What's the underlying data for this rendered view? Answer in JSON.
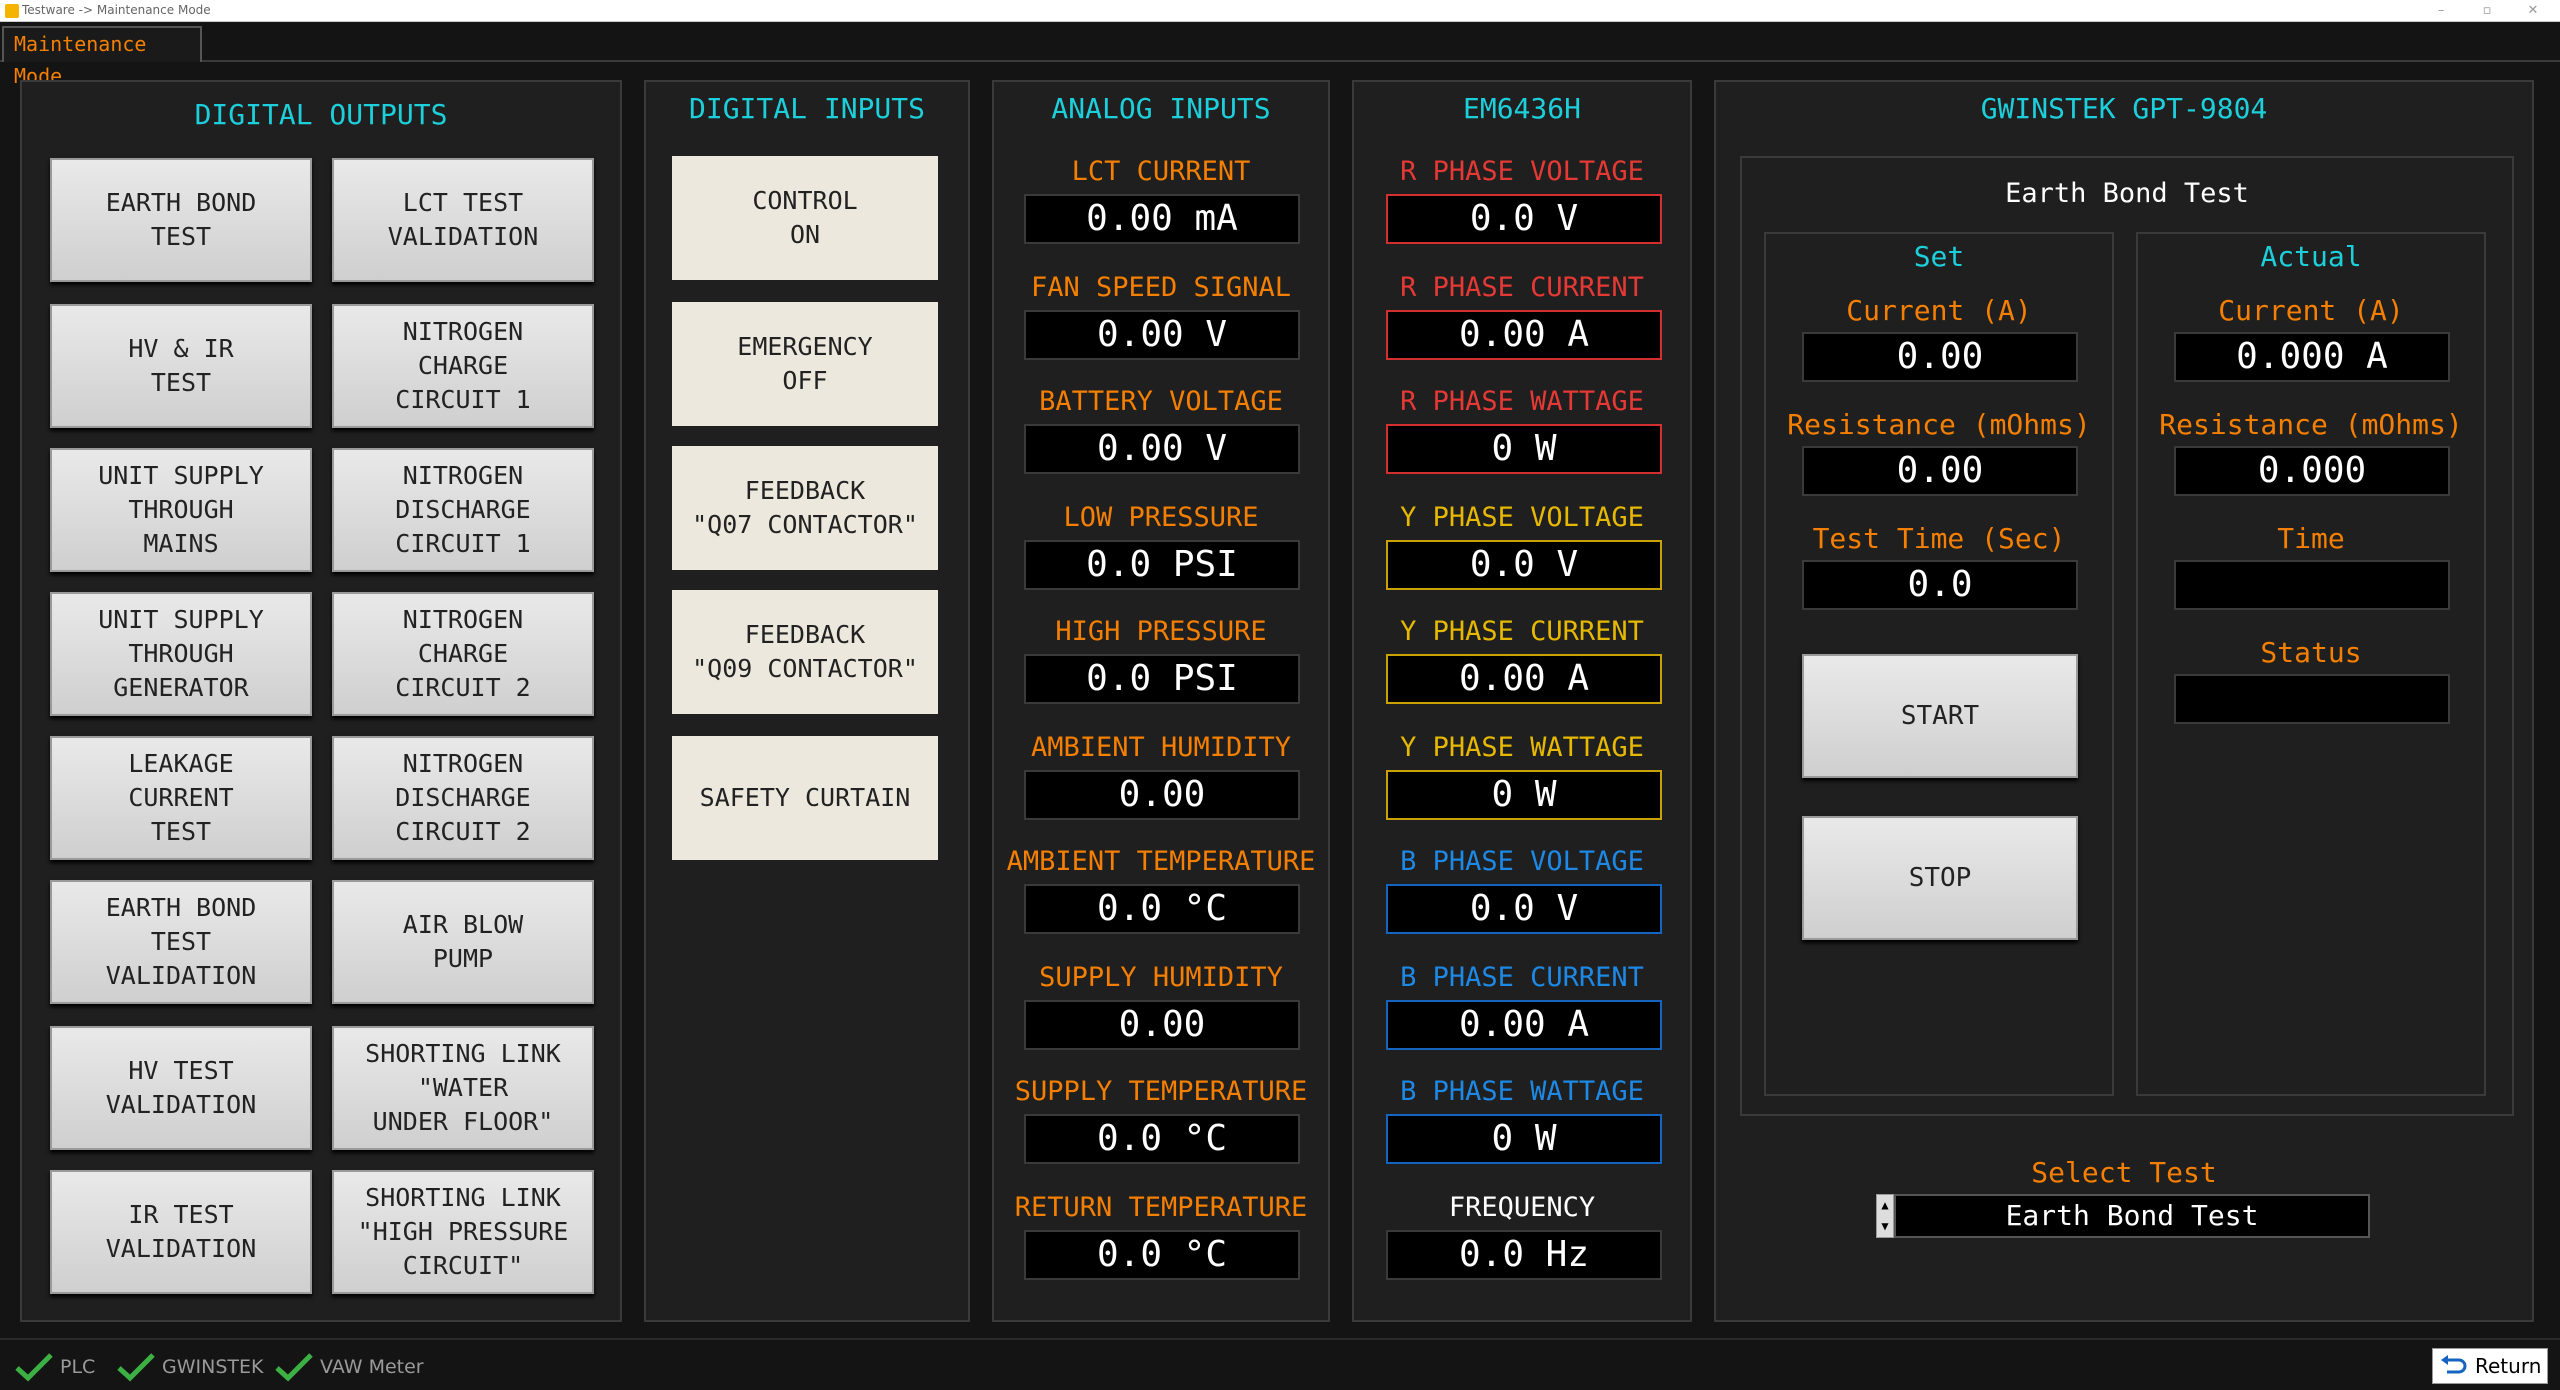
{
  "window": {
    "title": "Testware -> Maintenance Mode",
    "min": "–",
    "max": "▫",
    "close": "✕"
  },
  "tab": {
    "label": "Maintenance Mode"
  },
  "digital_outputs": {
    "title": "DIGITAL OUTPUTS",
    "left": [
      "EARTH BOND\nTEST",
      "HV & IR\nTEST",
      "UNIT SUPPLY\nTHROUGH\nMAINS",
      "UNIT SUPPLY\nTHROUGH\nGENERATOR",
      "LEAKAGE\nCURRENT\nTEST",
      "EARTH BOND\nTEST\nVALIDATION",
      "HV TEST\nVALIDATION",
      "IR TEST\nVALIDATION"
    ],
    "right": [
      "LCT TEST\nVALIDATION",
      "NITROGEN\nCHARGE\nCIRCUIT 1",
      "NITROGEN\nDISCHARGE\nCIRCUIT 1",
      "NITROGEN\nCHARGE\nCIRCUIT 2",
      "NITROGEN\nDISCHARGE\nCIRCUIT 2",
      "AIR BLOW\nPUMP",
      "SHORTING LINK\n\"WATER\nUNDER FLOOR\"",
      "SHORTING LINK\n\"HIGH PRESSURE\nCIRCUIT\""
    ]
  },
  "digital_inputs": {
    "title": "DIGITAL INPUTS",
    "items": [
      "CONTROL\nON",
      "EMERGENCY\nOFF",
      "FEEDBACK\n\"Q07 CONTACTOR\"",
      "FEEDBACK\n\"Q09 CONTACTOR\"",
      "SAFETY CURTAIN"
    ]
  },
  "analog_inputs": {
    "title": "ANALOG INPUTS",
    "items": [
      {
        "label": "LCT CURRENT",
        "value": "0.00 mA"
      },
      {
        "label": "FAN SPEED SIGNAL",
        "value": "0.00 V"
      },
      {
        "label": "BATTERY VOLTAGE",
        "value": "0.00 V"
      },
      {
        "label": "LOW PRESSURE",
        "value": "0.0 PSI"
      },
      {
        "label": "HIGH PRESSURE",
        "value": "0.0 PSI"
      },
      {
        "label": "AMBIENT HUMIDITY",
        "value": "0.00"
      },
      {
        "label": "AMBIENT TEMPERATURE",
        "value": "0.0 °C"
      },
      {
        "label": "SUPPLY HUMIDITY",
        "value": "0.00"
      },
      {
        "label": "SUPPLY TEMPERATURE",
        "value": "0.0 °C"
      },
      {
        "label": "RETURN TEMPERATURE",
        "value": "0.0 °C"
      }
    ]
  },
  "em6436h": {
    "title": "EM6436H",
    "items": [
      {
        "label": "R PHASE VOLTAGE",
        "value": "0.0 V",
        "color": "#e53935"
      },
      {
        "label": "R PHASE CURRENT",
        "value": "0.00 A",
        "color": "#e53935"
      },
      {
        "label": "R PHASE WATTAGE",
        "value": "0 W",
        "color": "#e53935"
      },
      {
        "label": "Y PHASE VOLTAGE",
        "value": "0.0 V",
        "color": "#e6b800"
      },
      {
        "label": "Y PHASE CURRENT",
        "value": "0.00 A",
        "color": "#e6b800"
      },
      {
        "label": "Y PHASE WATTAGE",
        "value": "0 W",
        "color": "#e6b800"
      },
      {
        "label": "B PHASE VOLTAGE",
        "value": "0.0 V",
        "color": "#1e88e5"
      },
      {
        "label": "B PHASE CURRENT",
        "value": "0.00 A",
        "color": "#1e88e5"
      },
      {
        "label": "B PHASE WATTAGE",
        "value": "0 W",
        "color": "#1e88e5"
      },
      {
        "label": "FREQUENCY",
        "value": "0.0 Hz",
        "color": "#ffffff"
      }
    ]
  },
  "gwinstek": {
    "title": "GWINSTEK GPT-9804",
    "test_title": "Earth Bond Test",
    "set": {
      "title": "Set",
      "current_label": "Current (A)",
      "current_value": "0.00",
      "resistance_label": "Resistance (mOhms)",
      "resistance_value": "0.00",
      "time_label": "Test Time (Sec)",
      "time_value": "0.0",
      "start": "START",
      "stop": "STOP"
    },
    "actual": {
      "title": "Actual",
      "current_label": "Current (A)",
      "current_value": "0.000 A",
      "resistance_label": "Resistance (mOhms)",
      "resistance_value": "0.000",
      "time_label": "Time",
      "time_value": "",
      "status_label": "Status",
      "status_value": ""
    },
    "select_label": "Select Test",
    "select_value": "Earth Bond Test",
    "spin_up": "▲",
    "spin_down": "▼"
  },
  "statusbar": {
    "items": [
      "PLC",
      "GWINSTEK",
      "VAW Meter"
    ],
    "return_label": "Return"
  },
  "colors": {
    "accent_cyan": "#1ccfda",
    "label_orange": "#f57f00",
    "ok_green": "#3cb043"
  }
}
